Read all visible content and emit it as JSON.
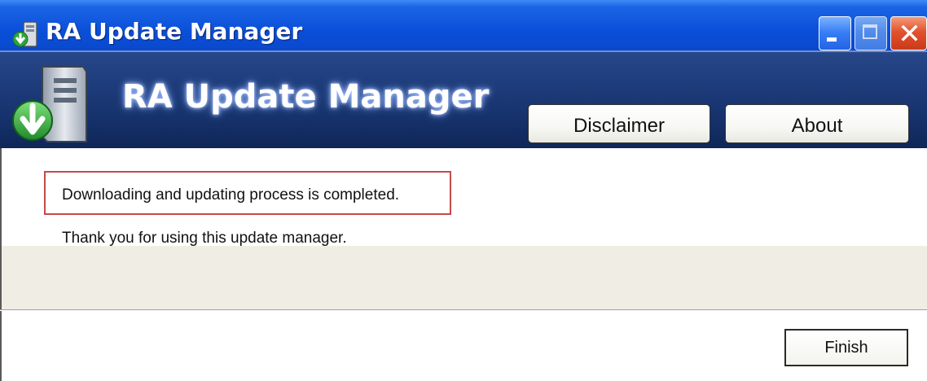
{
  "window": {
    "title": "RA Update Manager"
  },
  "banner": {
    "title": "RA Update Manager",
    "disclaimer_label": "Disclaimer",
    "about_label": "About"
  },
  "content": {
    "status_message": "Downloading and updating process is completed.",
    "thank_you_message": "Thank you for using this update manager."
  },
  "footer": {
    "finish_label": "Finish"
  },
  "icons": {
    "title_icon": "update-manager-icon",
    "banner_logo": "server-download-icon",
    "minimize": "minimize-icon",
    "maximize": "maximize-icon",
    "close": "close-icon"
  },
  "colors": {
    "titlebar": "#0a4fd8",
    "banner": "#1e3c7b",
    "status_box_border": "#c44a4a",
    "band": "#f0eee4"
  }
}
